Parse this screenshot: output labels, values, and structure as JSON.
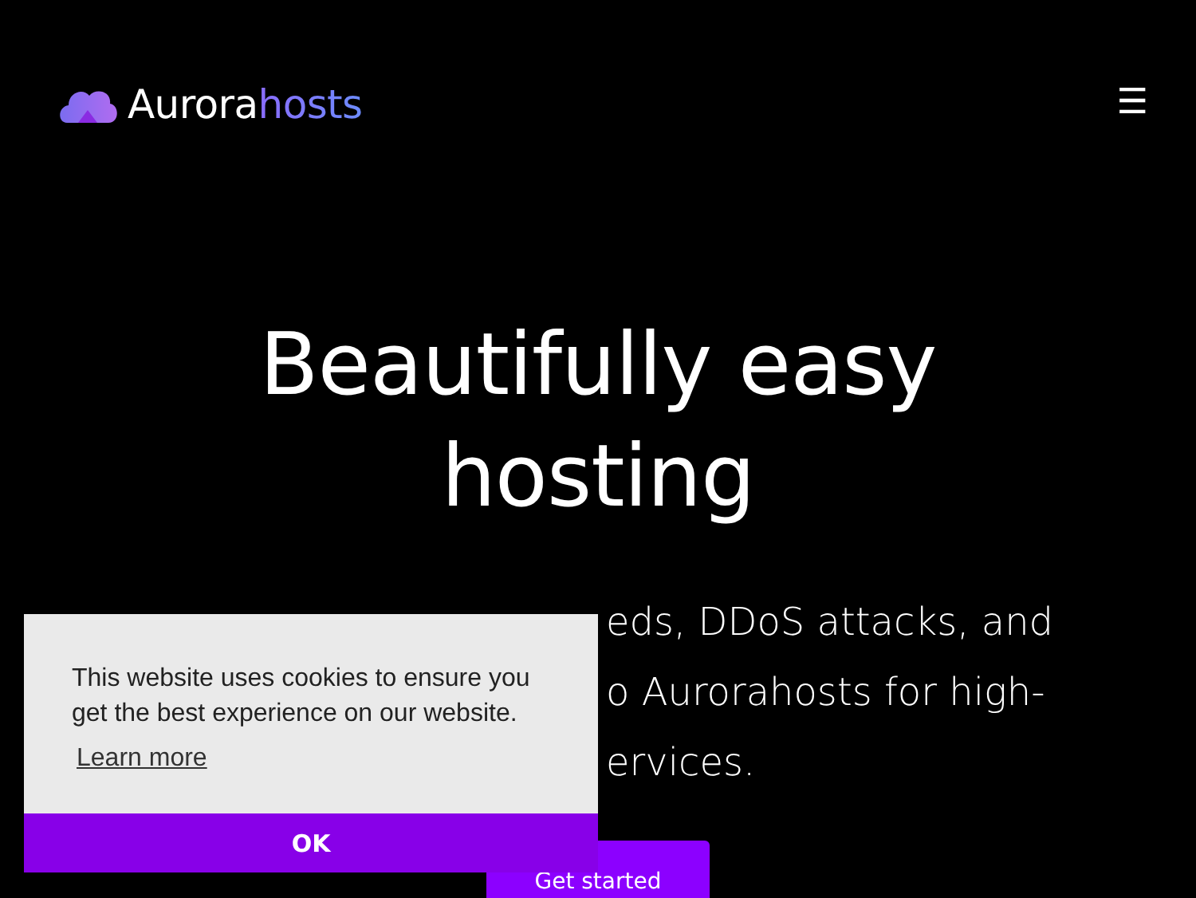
{
  "header": {
    "logo": {
      "first": "Aurora",
      "second": "hosts"
    },
    "menu_icon": "☰"
  },
  "hero": {
    "heading": "Beautifully easy hosting",
    "text_lines": [
      "eds, DDoS attacks, and",
      "o Aurorahosts for high-",
      "ervices."
    ],
    "button": "Get started"
  },
  "cookie_banner": {
    "message": "This website uses cookies to ensure you get the best experience on our website.",
    "link": "Learn more",
    "button": "OK"
  }
}
